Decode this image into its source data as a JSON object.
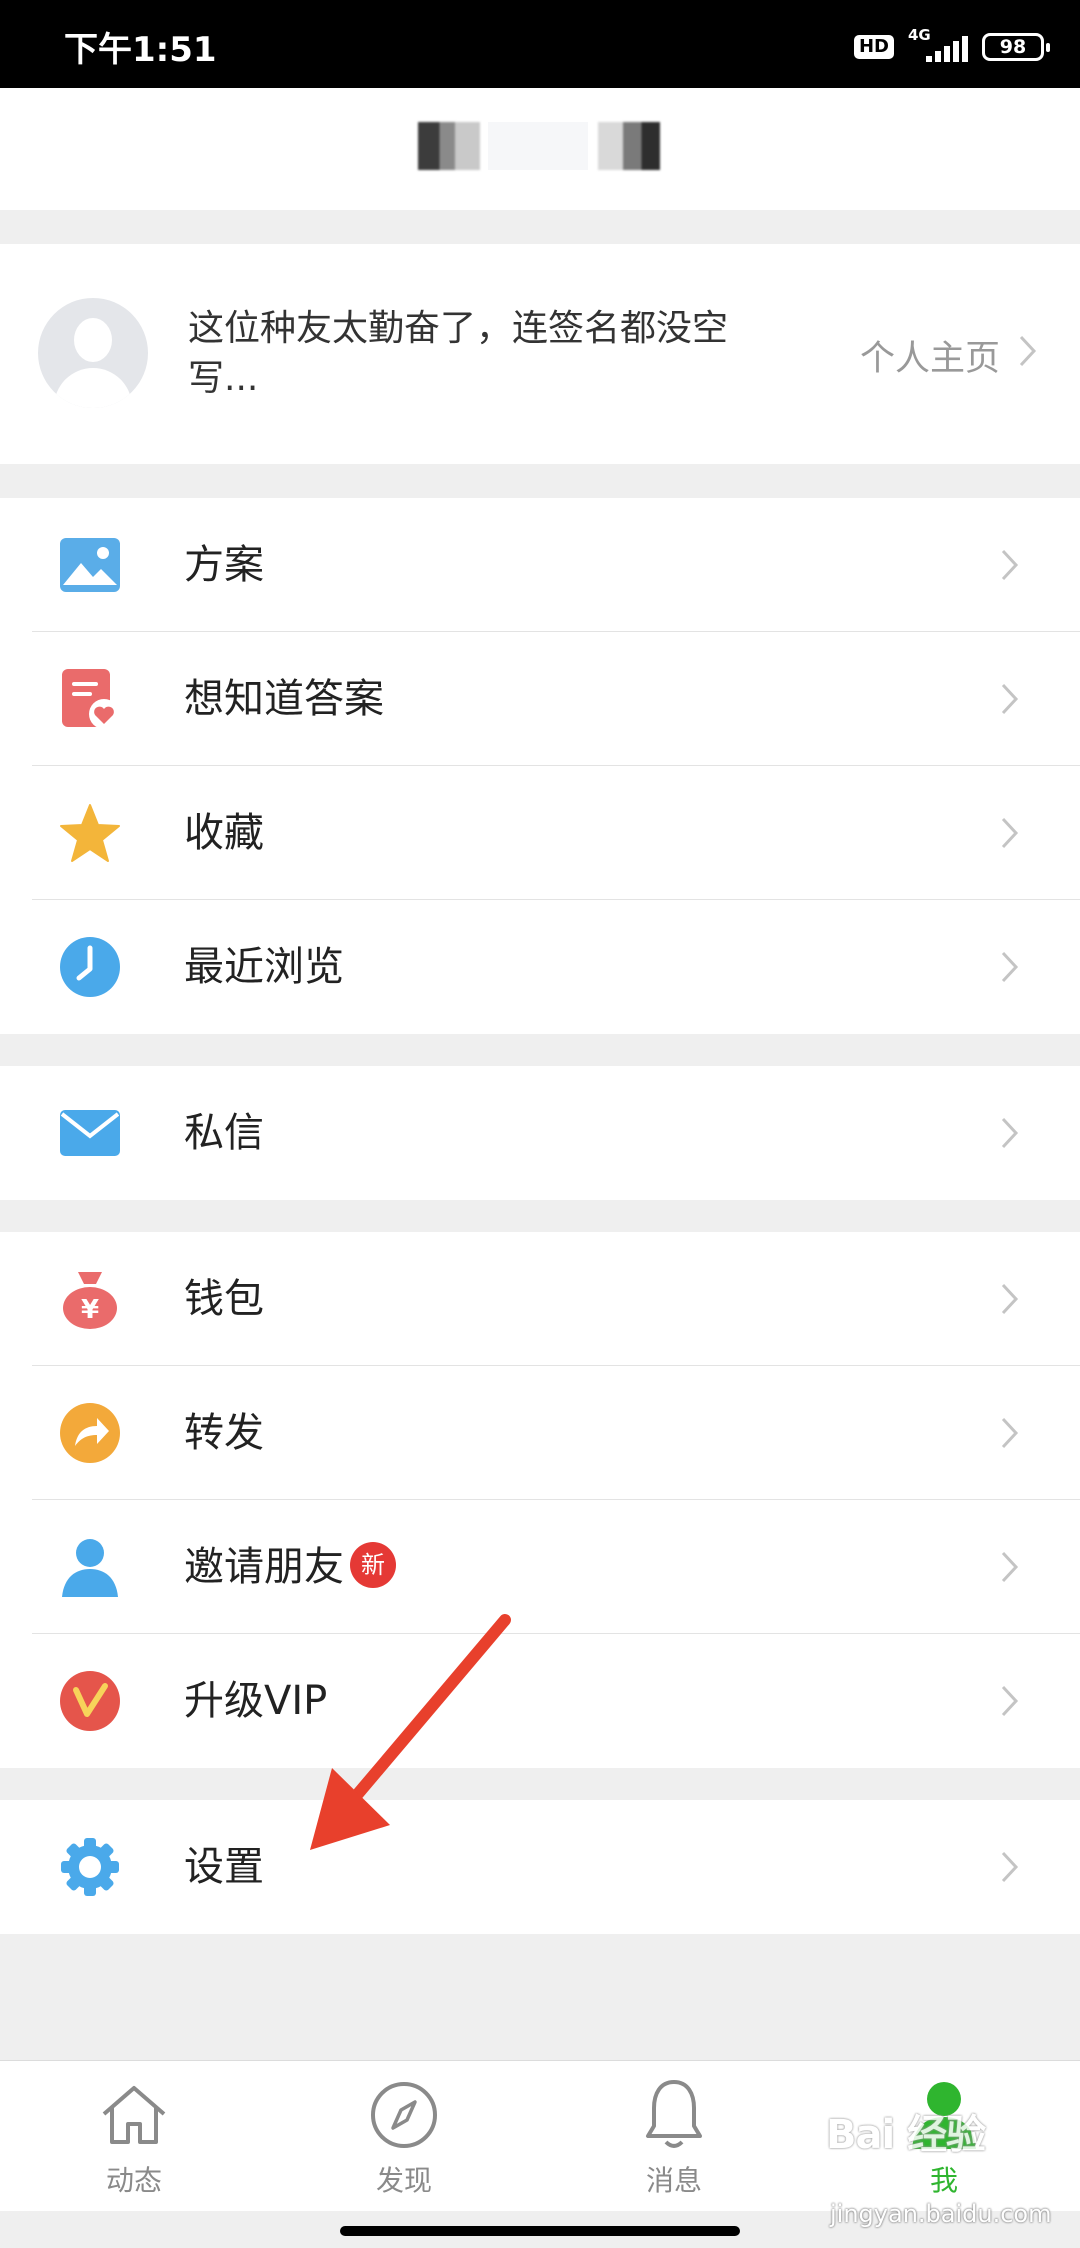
{
  "status_bar": {
    "time": "下午1:51",
    "hd": "HD",
    "network": "4G",
    "battery": "98"
  },
  "profile": {
    "signature": "这位种友太勤奋了，连签名都没空写...",
    "homepage_link": "个人主页"
  },
  "menu_groups": [
    [
      {
        "label": "方案",
        "icon": "image-icon",
        "color": "#5aade8"
      },
      {
        "label": "想知道答案",
        "icon": "note-heart-icon",
        "color": "#ea6b6b"
      },
      {
        "label": "收藏",
        "icon": "star-icon",
        "color": "#f3b53a"
      },
      {
        "label": "最近浏览",
        "icon": "clock-icon",
        "color": "#4aa9ea"
      }
    ],
    [
      {
        "label": "私信",
        "icon": "envelope-icon",
        "color": "#4aa9ea"
      }
    ],
    [
      {
        "label": "钱包",
        "icon": "money-bag-icon",
        "color": "#ea6b6b"
      },
      {
        "label": "转发",
        "icon": "share-arrow-icon",
        "color": "#f3a93a"
      },
      {
        "label": "邀请朋友",
        "icon": "person-icon",
        "color": "#4aa9ea",
        "badge": "新"
      },
      {
        "label": "升级VIP",
        "icon": "vip-icon",
        "color": "#e5554b"
      }
    ],
    [
      {
        "label": "设置",
        "icon": "gear-icon",
        "color": "#4aa9ea"
      }
    ]
  ],
  "tabs": [
    {
      "label": "动态",
      "icon": "home-icon"
    },
    {
      "label": "发现",
      "icon": "compass-icon"
    },
    {
      "label": "消息",
      "icon": "bell-icon"
    },
    {
      "label": "我",
      "icon": "user-icon",
      "active": true
    }
  ],
  "colors": {
    "active_tab": "#2fb52f",
    "arrow": "#e8402c"
  },
  "watermark": {
    "brand": "Bai 经验",
    "domain": "jingyan.baidu.com"
  }
}
